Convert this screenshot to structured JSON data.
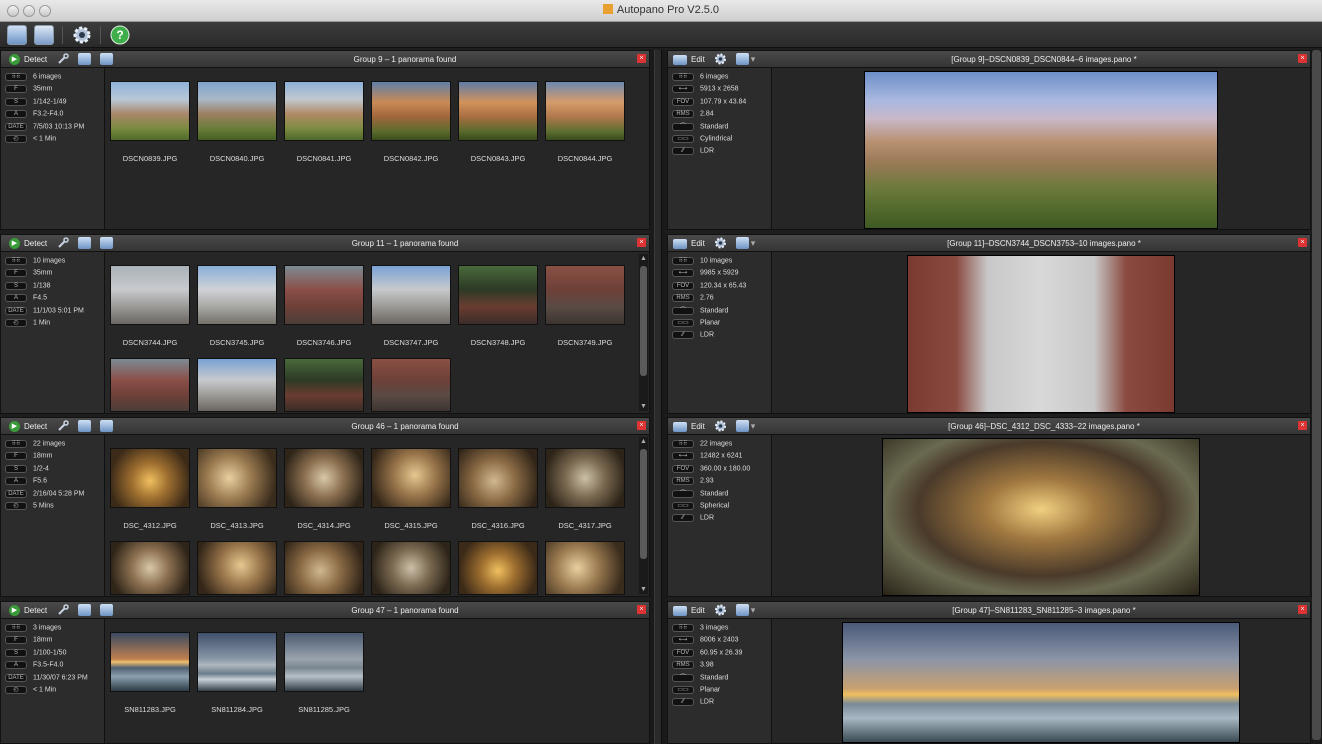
{
  "window": {
    "title": "Autopano Pro V2.5.0"
  },
  "toolbar": {
    "icons": [
      "import-images-icon",
      "panorama-folder-icon",
      "settings-gear-icon",
      "help-icon"
    ]
  },
  "detect_label": "Detect",
  "edit_label": "Edit",
  "close_glyph": "×",
  "info_badges": {
    "images": "⠿⠿",
    "focal": "F",
    "shutter": "S",
    "aperture": "A",
    "date": "DATE",
    "time": "◴",
    "size": "⟷",
    "fov": "FOV",
    "rms": "RMS",
    "blend": "⌒",
    "projection": "▭▭",
    "mode": "⁄⁄"
  },
  "groups": [
    {
      "title": "Group 9 – 1 panorama found",
      "images": "6 images",
      "focal": "35mm",
      "shutter": "1/142-1/49",
      "aperture": "F3.2-F4.0",
      "date": "7/5/03 10:13 PM",
      "duration": "< 1 Min",
      "thumbs": [
        "DSCN0839.JPG",
        "DSCN0840.JPG",
        "DSCN0841.JPG",
        "DSCN0842.JPG",
        "DSCN0843.JPG",
        "DSCN0844.JPG"
      ],
      "pano": {
        "title": "[Group 9]–DSCN0839_DSCN0844–6 images.pano *",
        "images": "6 images",
        "size": "5913 x 2658",
        "fov": "107.79 x 43.84",
        "rms": "2.84",
        "blend": "Standard",
        "projection": "Cylindrical",
        "mode": "LDR"
      }
    },
    {
      "title": "Group 11 – 1 panorama found",
      "images": "10 images",
      "focal": "35mm",
      "shutter": "1/138",
      "aperture": "F4.5",
      "date": "11/1/03 5:01 PM",
      "duration": "1 Min",
      "thumbs": [
        "DSCN3744.JPG",
        "DSCN3745.JPG",
        "DSCN3746.JPG",
        "DSCN3747.JPG",
        "DSCN3748.JPG",
        "DSCN3749.JPG"
      ],
      "pano": {
        "title": "[Group 11]–DSCN3744_DSCN3753–10 images.pano *",
        "images": "10 images",
        "size": "9985 x 5929",
        "fov": "120.34 x 65.43",
        "rms": "2.76",
        "blend": "Standard",
        "projection": "Planar",
        "mode": "LDR"
      }
    },
    {
      "title": "Group 46 – 1 panorama found",
      "images": "22 images",
      "focal": "18mm",
      "shutter": "1/2-4",
      "aperture": "F5.6",
      "date": "2/16/04 5:28 PM",
      "duration": "5 Mins",
      "thumbs": [
        "DSC_4312.JPG",
        "DSC_4313.JPG",
        "DSC_4314.JPG",
        "DSC_4315.JPG",
        "DSC_4316.JPG",
        "DSC_4317.JPG"
      ],
      "pano": {
        "title": "[Group 46]–DSC_4312_DSC_4333–22 images.pano *",
        "images": "22 images",
        "size": "12482 x 6241",
        "fov": "360.00 x 180.00",
        "rms": "2.93",
        "blend": "Standard",
        "projection": "Spherical",
        "mode": "LDR"
      }
    },
    {
      "title": "Group 47 – 1 panorama found",
      "images": "3 images",
      "focal": "18mm",
      "shutter": "1/100-1/50",
      "aperture": "F3.5-F4.0",
      "date": "11/30/07 6:23 PM",
      "duration": "< 1 Min",
      "thumbs": [
        "SN811283.JPG",
        "SN811284.JPG",
        "SN811285.JPG"
      ],
      "pano": {
        "title": "[Group 47]–SN811283_SN811285–3 images.pano *",
        "images": "3 images",
        "size": "8006 x 2403",
        "fov": "60.95 x 26.39",
        "rms": "3.98",
        "blend": "Standard",
        "projection": "Planar",
        "mode": "LDR"
      }
    }
  ]
}
